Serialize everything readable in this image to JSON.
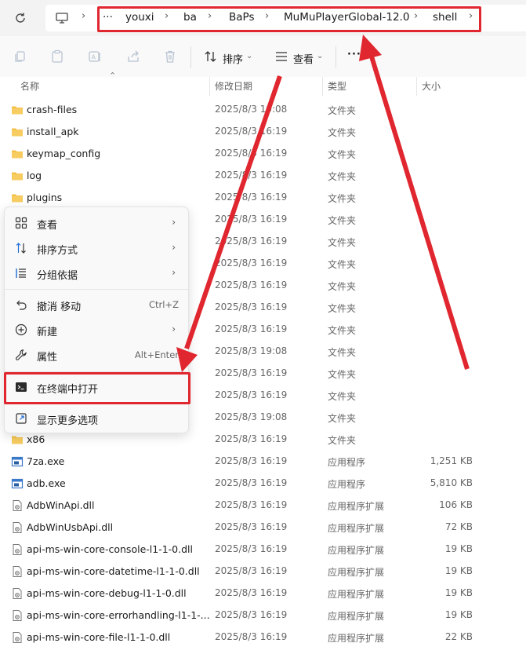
{
  "breadcrumbs": [
    "youxi",
    "ba",
    "BaPs",
    "MuMuPlayerGlobal-12.0",
    "shell"
  ],
  "breadcrumb_overflow": "···",
  "toolbar": {
    "sort_label": "排序",
    "view_label": "查看",
    "more_label": "···"
  },
  "columns": {
    "name": "名称",
    "date": "修改日期",
    "type": "类型",
    "size": "大小"
  },
  "rows": [
    {
      "name": "crash-files",
      "date": "2025/8/3 19:08",
      "type": "文件夹",
      "size": "",
      "kind": "folder"
    },
    {
      "name": "install_apk",
      "date": "2025/8/3 16:19",
      "type": "文件夹",
      "size": "",
      "kind": "folder"
    },
    {
      "name": "keymap_config",
      "date": "2025/8/3 16:19",
      "type": "文件夹",
      "size": "",
      "kind": "folder"
    },
    {
      "name": "log",
      "date": "2025/8/3 16:19",
      "type": "文件夹",
      "size": "",
      "kind": "folder"
    },
    {
      "name": "plugins",
      "date": "2025/8/3 16:19",
      "type": "文件夹",
      "size": "",
      "kind": "folder"
    },
    {
      "name": "",
      "date": "2025/8/3 16:19",
      "type": "文件夹",
      "size": "",
      "kind": "hidden"
    },
    {
      "name": "",
      "date": "2025/8/3 16:19",
      "type": "文件夹",
      "size": "",
      "kind": "hidden"
    },
    {
      "name": "",
      "date": "2025/8/3 16:19",
      "type": "文件夹",
      "size": "",
      "kind": "hidden"
    },
    {
      "name": "",
      "date": "2025/8/3 16:19",
      "type": "文件夹",
      "size": "",
      "kind": "hidden"
    },
    {
      "name": "",
      "date": "2025/8/3 16:19",
      "type": "文件夹",
      "size": "",
      "kind": "hidden"
    },
    {
      "name": "",
      "date": "2025/8/3 16:19",
      "type": "文件夹",
      "size": "",
      "kind": "hidden"
    },
    {
      "name": "",
      "date": "2025/8/3 19:08",
      "type": "文件夹",
      "size": "",
      "kind": "hidden"
    },
    {
      "name": "",
      "date": "2025/8/3 16:19",
      "type": "文件夹",
      "size": "",
      "kind": "hidden"
    },
    {
      "name": "",
      "date": "2025/8/3 16:19",
      "type": "文件夹",
      "size": "",
      "kind": "hidden"
    },
    {
      "name": "",
      "date": "2025/8/3 19:08",
      "type": "文件夹",
      "size": "",
      "kind": "hidden"
    },
    {
      "name": "x86",
      "date": "2025/8/3 16:19",
      "type": "文件夹",
      "size": "",
      "kind": "folder"
    },
    {
      "name": "7za.exe",
      "date": "2025/8/3 16:19",
      "type": "应用程序",
      "size": "1,251 KB",
      "kind": "exe"
    },
    {
      "name": "adb.exe",
      "date": "2025/8/3 16:19",
      "type": "应用程序",
      "size": "5,810 KB",
      "kind": "exe"
    },
    {
      "name": "AdbWinApi.dll",
      "date": "2025/8/3 16:19",
      "type": "应用程序扩展",
      "size": "106 KB",
      "kind": "dll"
    },
    {
      "name": "AdbWinUsbApi.dll",
      "date": "2025/8/3 16:19",
      "type": "应用程序扩展",
      "size": "72 KB",
      "kind": "dll"
    },
    {
      "name": "api-ms-win-core-console-l1-1-0.dll",
      "date": "2025/8/3 16:19",
      "type": "应用程序扩展",
      "size": "19 KB",
      "kind": "dll"
    },
    {
      "name": "api-ms-win-core-datetime-l1-1-0.dll",
      "date": "2025/8/3 16:19",
      "type": "应用程序扩展",
      "size": "19 KB",
      "kind": "dll"
    },
    {
      "name": "api-ms-win-core-debug-l1-1-0.dll",
      "date": "2025/8/3 16:19",
      "type": "应用程序扩展",
      "size": "19 KB",
      "kind": "dll"
    },
    {
      "name": "api-ms-win-core-errorhandling-l1-1-...",
      "date": "2025/8/3 16:19",
      "type": "应用程序扩展",
      "size": "19 KB",
      "kind": "dll"
    },
    {
      "name": "api-ms-win-core-file-l1-1-0.dll",
      "date": "2025/8/3 16:19",
      "type": "应用程序扩展",
      "size": "22 KB",
      "kind": "dll"
    }
  ],
  "context_menu": {
    "items": [
      {
        "label": "查看",
        "shortcut": "",
        "submenu": true,
        "icon": "view-grid-icon"
      },
      {
        "label": "排序方式",
        "shortcut": "",
        "submenu": true,
        "icon": "sort-icon"
      },
      {
        "label": "分组依据",
        "shortcut": "",
        "submenu": true,
        "icon": "group-list-icon"
      },
      {
        "label": "撤消 移动",
        "shortcut": "Ctrl+Z",
        "submenu": false,
        "icon": "undo-icon"
      },
      {
        "label": "新建",
        "shortcut": "",
        "submenu": true,
        "icon": "new-plus-icon"
      },
      {
        "label": "属性",
        "shortcut": "Alt+Enter",
        "submenu": false,
        "icon": "wrench-icon"
      },
      {
        "label": "在终端中打开",
        "shortcut": "",
        "submenu": false,
        "icon": "terminal-icon"
      },
      {
        "label": "显示更多选项",
        "shortcut": "",
        "submenu": false,
        "icon": "more-options-icon"
      }
    ]
  },
  "colors": {
    "highlight": "#e0262f",
    "folder": "#f4c14a",
    "accent": "#1f6fd6"
  }
}
